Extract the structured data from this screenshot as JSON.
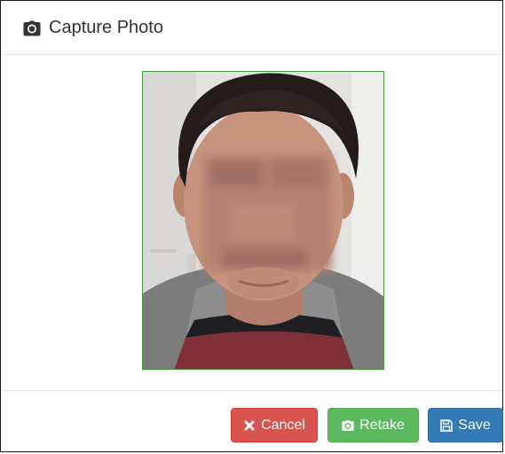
{
  "dialog": {
    "title": "Capture Photo",
    "title_icon": "camera-icon"
  },
  "photo": {
    "subject": "webcam portrait with blurred face",
    "border_color": "#3c9a3c"
  },
  "buttons": {
    "cancel": {
      "label": "Cancel",
      "icon": "times-icon",
      "color": "#d9534f"
    },
    "retake": {
      "label": "Retake",
      "icon": "camera-icon",
      "color": "#5cb85c"
    },
    "save": {
      "label": "Save",
      "icon": "floppy-disk-icon",
      "color": "#337ab7"
    }
  }
}
